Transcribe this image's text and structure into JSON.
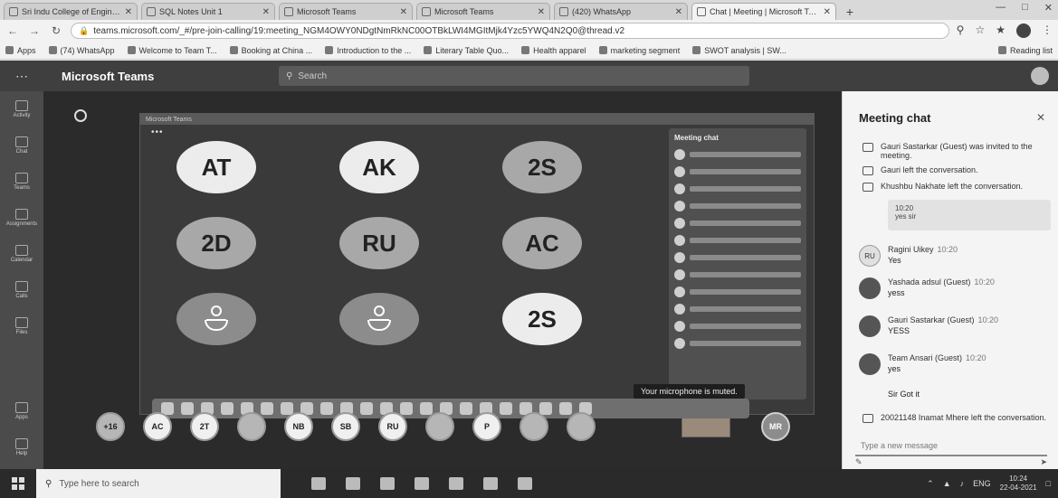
{
  "browser": {
    "tabs": [
      {
        "title": "Sri Indu College of Engineering",
        "active": false
      },
      {
        "title": "SQL Notes Unit 1",
        "active": false
      },
      {
        "title": "Microsoft Teams",
        "active": false
      },
      {
        "title": "Microsoft Teams",
        "active": false
      },
      {
        "title": "(420) WhatsApp",
        "active": false
      },
      {
        "title": "Chat | Meeting | Microsoft Teams",
        "active": true
      }
    ],
    "new_tab": "+",
    "url": "teams.microsoft.com/_#/pre-join-calling/19:meeting_NGM4OWY0NDgtNmRkNC00OTBkLWI4MGItMjk4Yzc5YWQ4N2Q0@thread.v2",
    "bookmarks": [
      "Apps",
      "(74) WhatsApp",
      "Welcome to Team T...",
      "Booking at China ...",
      "Introduction to the ...",
      "Literary Table Quo...",
      "Health apparel",
      "marketing segment",
      "SWOT analysis | SW..."
    ],
    "reading_list": "Reading list"
  },
  "teams": {
    "app_name": "Microsoft Teams",
    "search_placeholder": "Search",
    "rail": [
      "Activity",
      "Chat",
      "Teams",
      "Assignments",
      "Calendar",
      "Calls",
      "Files"
    ],
    "rail_bottom": [
      "Apps",
      "Help"
    ]
  },
  "stage": {
    "tiles": [
      {
        "label": "AT",
        "tone": "light"
      },
      {
        "label": "AK",
        "tone": "light"
      },
      {
        "label": "2S",
        "tone": "grey"
      },
      {
        "label": "2D",
        "tone": "grey"
      },
      {
        "label": "RU",
        "tone": "grey"
      },
      {
        "label": "AC",
        "tone": "grey"
      },
      {
        "label": "",
        "tone": "darkgrey",
        "person": true
      },
      {
        "label": "",
        "tone": "darkgrey",
        "person": true
      },
      {
        "label": "2S",
        "tone": "light"
      }
    ],
    "inner_chat_title": "Meeting chat",
    "mic_toast": "Your microphone is muted.",
    "participants": [
      {
        "label": "+16",
        "tone": "dark"
      },
      {
        "label": "AC",
        "tone": "light"
      },
      {
        "label": "2T",
        "tone": "light"
      },
      {
        "label": "",
        "tone": "dark"
      },
      {
        "label": "NB",
        "tone": "light"
      },
      {
        "label": "SB",
        "tone": "light"
      },
      {
        "label": "RU",
        "tone": "light"
      },
      {
        "label": "",
        "tone": "dark"
      },
      {
        "label": "P",
        "tone": "light"
      },
      {
        "label": "",
        "tone": "dark"
      },
      {
        "label": "",
        "tone": "dark"
      }
    ],
    "me": "MR"
  },
  "chat": {
    "title": "Meeting chat",
    "system": [
      "Gauri Sastarkar (Guest) was invited to the meeting.",
      "Gauri left the conversation.",
      "Khushbu Nakhate left the conversation."
    ],
    "self_bubble": {
      "time": "10:20",
      "text": "yes sir"
    },
    "messages": [
      {
        "initials": "RU",
        "name": "Ragini Uikey",
        "time": "10:20",
        "text": "Yes",
        "light": true
      },
      {
        "initials": "",
        "name": "Yashada adsul (Guest)",
        "time": "10:20",
        "text": "yess",
        "light": false
      },
      {
        "initials": "",
        "name": "Gauri Sastarkar (Guest)",
        "time": "10:20",
        "text": "YESS",
        "light": false
      },
      {
        "initials": "",
        "name": "Team Ansari (Guest)",
        "time": "10:20",
        "text": "yes",
        "light": false
      }
    ],
    "plain": "Sir Got it",
    "last_system": "20021148 Inamat Mhere left the conversation.",
    "compose_placeholder": "Type a new message"
  },
  "taskbar": {
    "search_placeholder": "Type here to search",
    "lang": "ENG",
    "time": "10:24",
    "date": "22-04-2021"
  }
}
